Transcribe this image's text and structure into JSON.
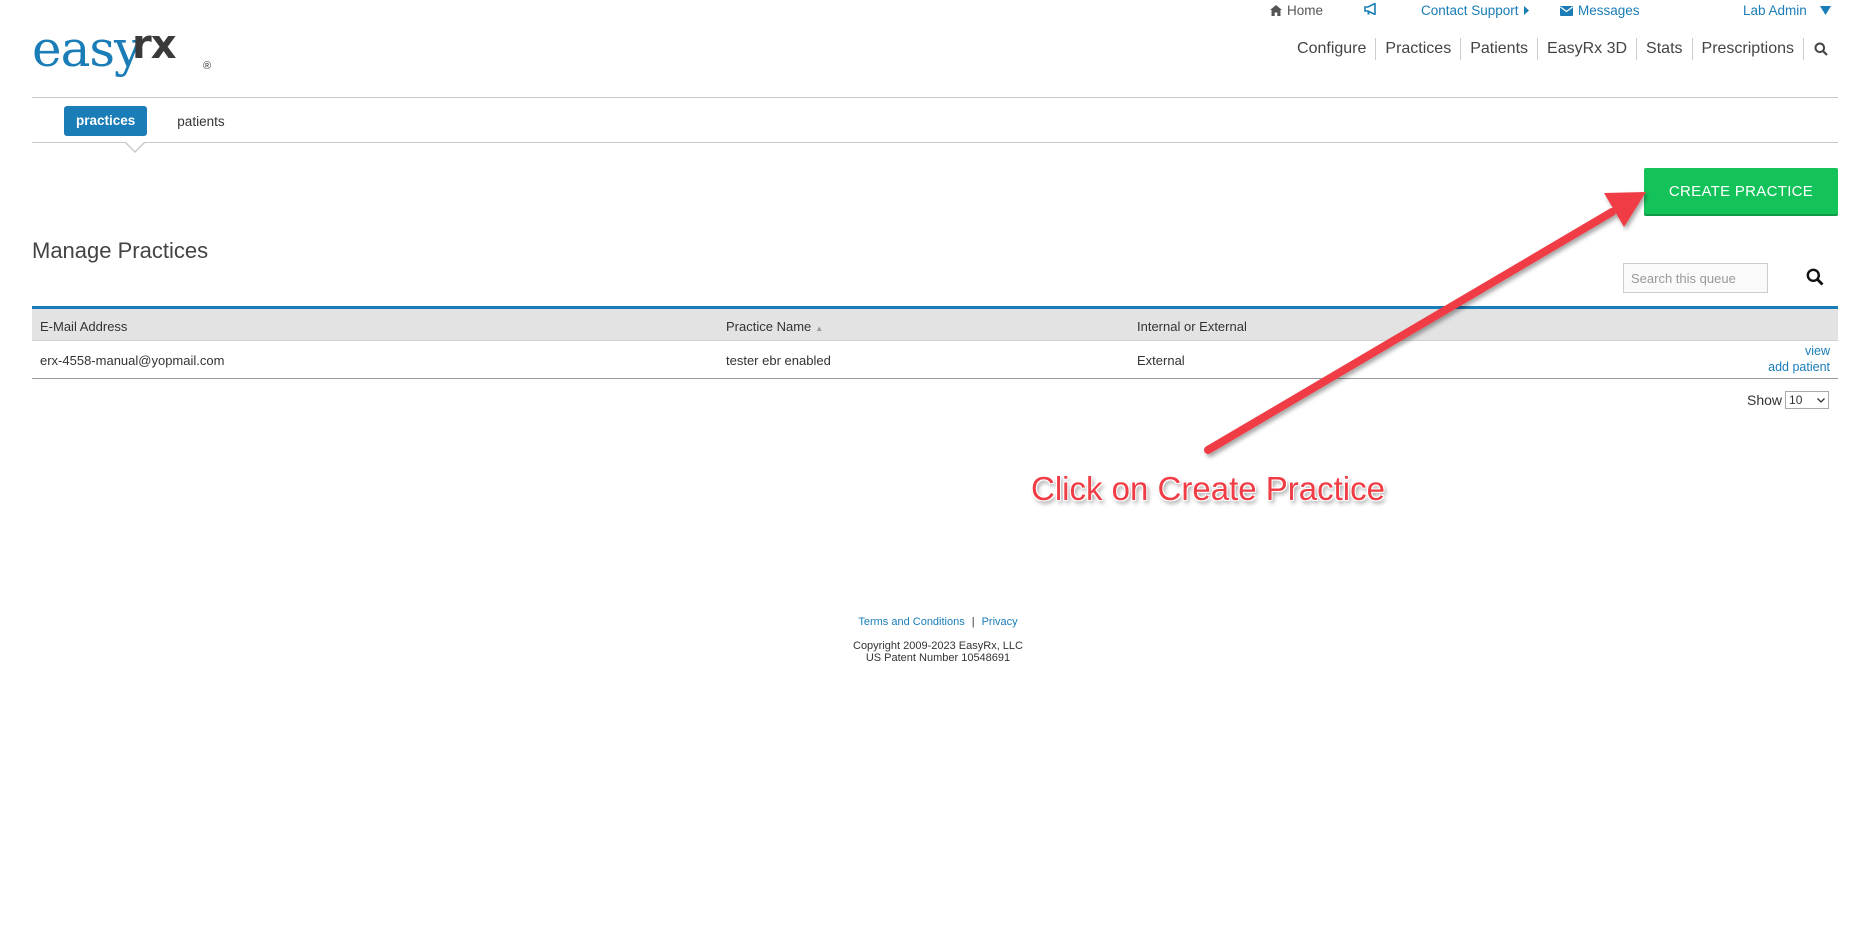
{
  "topbar": {
    "home": "Home",
    "contact_support": "Contact Support",
    "messages": "Messages",
    "user": "Lab Admin"
  },
  "logo": {
    "easy": "easy",
    "rx": "rx",
    "registered": "®"
  },
  "main_nav": [
    "Configure",
    "Practices",
    "Patients",
    "EasyRx 3D",
    "Stats",
    "Prescriptions"
  ],
  "sub_nav": {
    "active": "practices",
    "other": "patients"
  },
  "create_button": "CREATE PRACTICE",
  "page_title": "Manage Practices",
  "search": {
    "placeholder": "Search this queue"
  },
  "table": {
    "columns": [
      "E-Mail Address",
      "Practice Name",
      "Internal or External"
    ],
    "rows": [
      {
        "email": "erx-4558-manual@yopmail.com",
        "practice_name": "tester ebr enabled",
        "internal_external": "External",
        "view": "view",
        "add_patient": "add patient"
      }
    ]
  },
  "show": {
    "label": "Show",
    "value": "10"
  },
  "annotation": "Click on Create Practice",
  "footer": {
    "terms": "Terms and Conditions",
    "separator": "|",
    "privacy": "Privacy",
    "copyright": "Copyright 2009-2023 EasyRx, LLC",
    "patent": "US Patent Number 10548691"
  },
  "colors": {
    "brand_blue": "#1a7db7",
    "create_green": "#14c25a",
    "annotation_red": "#f03c44"
  }
}
